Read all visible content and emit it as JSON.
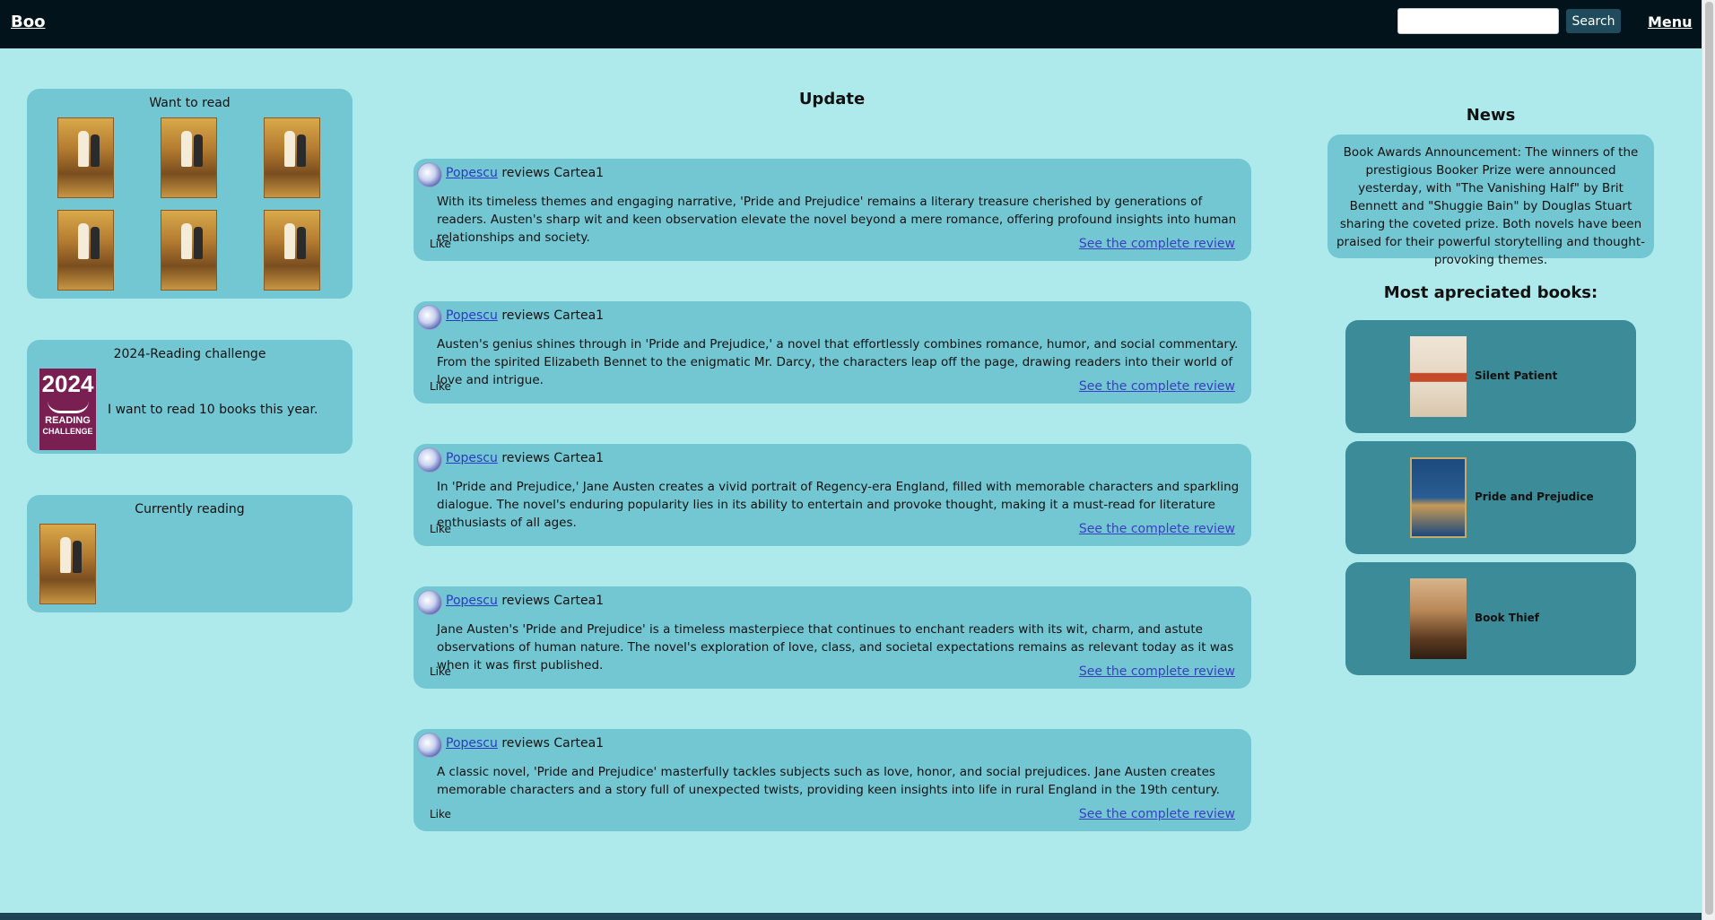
{
  "header": {
    "logo": "Boo",
    "search_placeholder": "",
    "search_button": "Search",
    "menu": "Menu"
  },
  "left": {
    "want_to_read": {
      "title": "Want to read",
      "covers": [
        "book-cover",
        "book-cover",
        "book-cover",
        "book-cover",
        "book-cover",
        "book-cover"
      ]
    },
    "challenge": {
      "title": "2024-Reading challenge",
      "badge_year": "2024",
      "badge_line1": "READING",
      "badge_line2": "CHALLENGE",
      "text": "I want to read 10 books this year."
    },
    "currently_reading": {
      "title": "Currently reading"
    }
  },
  "center": {
    "title": "Update",
    "reviews": [
      {
        "user": "Popescu",
        "action": "reviews Cartea1",
        "body": "With its timeless themes and engaging narrative, 'Pride and Prejudice' remains a literary treasure cherished by generations of readers. Austen's sharp wit and keen observation elevate the novel beyond a mere romance, offering profound insights into human relationships and society.",
        "like": "Like",
        "more": "See the complete review"
      },
      {
        "user": "Popescu",
        "action": "reviews Cartea1",
        "body": "Austen's genius shines through in 'Pride and Prejudice,' a novel that effortlessly combines romance, humor, and social commentary. From the spirited Elizabeth Bennet to the enigmatic Mr. Darcy, the characters leap off the page, drawing readers into their world of love and intrigue.",
        "like": "Like",
        "more": "See the complete review"
      },
      {
        "user": "Popescu",
        "action": "reviews Cartea1",
        "body": "In 'Pride and Prejudice,' Jane Austen creates a vivid portrait of Regency-era England, filled with memorable characters and sparkling dialogue. The novel's enduring popularity lies in its ability to entertain and provoke thought, making it a must-read for literature enthusiasts of all ages.",
        "like": "Like",
        "more": "See the complete review"
      },
      {
        "user": "Popescu",
        "action": "reviews Cartea1",
        "body": "Jane Austen's 'Pride and Prejudice' is a timeless masterpiece that continues to enchant readers with its wit, charm, and astute observations of human nature. The novel's exploration of love, class, and societal expectations remains as relevant today as it was when it was first published.",
        "like": "Like",
        "more": "See the complete review"
      },
      {
        "user": "Popescu",
        "action": "reviews Cartea1",
        "body": "A classic novel, 'Pride and Prejudice' masterfully tackles subjects such as love, honor, and social prejudices. Jane Austen creates memorable characters and a story full of unexpected twists, providing keen insights into life in rural England in the 19th century.",
        "like": "Like",
        "more": "See the complete review"
      }
    ]
  },
  "right": {
    "news_title": "News",
    "news_text": "Book Awards Announcement: The winners of the prestigious Booker Prize were announced yesterday, with \"The Vanishing Half\" by Brit Bennett and \"Shuggie Bain\" by Douglas Stuart sharing the coveted prize. Both novels have been praised for their powerful storytelling and thought-provoking themes.",
    "most_title": "Most apreciated books:",
    "books": [
      {
        "title": "Silent Patient"
      },
      {
        "title": "Pride and Prejudice"
      },
      {
        "title": "Book Thief"
      }
    ]
  }
}
